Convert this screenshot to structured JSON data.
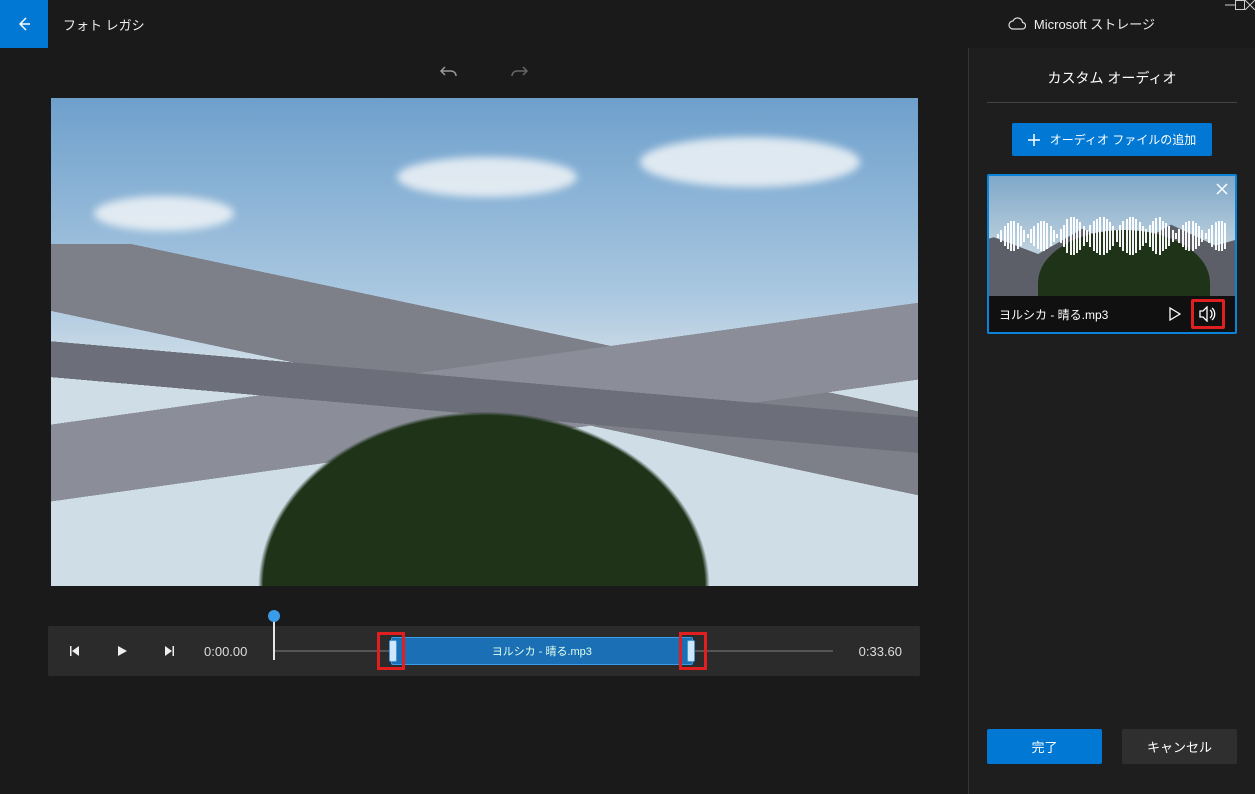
{
  "app": {
    "title": "フォト レガシ"
  },
  "storage": {
    "label": "Microsoft ストレージ"
  },
  "timeline": {
    "current_time": "0:00.00",
    "duration": "0:33.60",
    "clip_label": "ヨルシカ - 晴る.mp3",
    "clip_start_pct": 21,
    "clip_end_pct": 75,
    "playhead_pct": 0
  },
  "side": {
    "title": "カスタム オーディオ",
    "add_label": "オーディオ ファイルの追加",
    "audio_name": "ヨルシカ - 晴る.mp3",
    "done_label": "完了",
    "cancel_label": "キャンセル"
  },
  "icons": {
    "back": "back-arrow-icon",
    "undo": "undo-icon",
    "redo": "redo-icon",
    "cloud": "cloud-icon",
    "minimize": "minimize-icon",
    "maximize": "maximize-icon",
    "close": "close-icon",
    "prev_frame": "prev-frame-icon",
    "play": "play-icon",
    "next_frame": "next-frame-icon",
    "plus": "plus-icon",
    "play_small": "play-small-icon",
    "volume": "volume-icon",
    "x": "x-icon"
  }
}
